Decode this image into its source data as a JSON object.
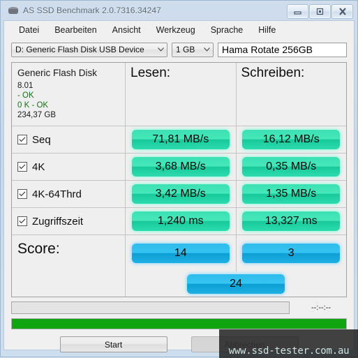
{
  "window": {
    "title": "AS SSD Benchmark 2.0.7316.34247",
    "icon": "disk-drive-icon",
    "buttons": {
      "minimize": "minimize-icon",
      "maximize": "restore-icon",
      "close": "close-icon"
    }
  },
  "menu": [
    "Datei",
    "Bearbeiten",
    "Ansicht",
    "Werkzeug",
    "Sprache",
    "Hilfe"
  ],
  "selector": {
    "drive": "D: Generic Flash Disk USB Device",
    "size": "1 GB",
    "name_value": "Hama Rotate 256GB",
    "name_placeholder": ""
  },
  "device_info": {
    "model": "Generic Flash Disk",
    "firmware": "8.01",
    "alignment": "- OK",
    "partition": "0 K - OK",
    "capacity": "234,37 GB"
  },
  "columns": {
    "read": "Lesen:",
    "write": "Schreiben:"
  },
  "rows": [
    {
      "label": "Seq",
      "checked": true,
      "read": "71,81 MB/s",
      "write": "16,12 MB/s"
    },
    {
      "label": "4K",
      "checked": true,
      "read": "3,68 MB/s",
      "write": "0,35 MB/s"
    },
    {
      "label": "4K-64Thrd",
      "checked": true,
      "read": "3,42 MB/s",
      "write": "1,35 MB/s"
    },
    {
      "label": "Zugriffszeit",
      "checked": true,
      "read": "1,240 ms",
      "write": "13,327 ms"
    }
  ],
  "score": {
    "label": "Score:",
    "read": "14",
    "write": "3",
    "total": "24"
  },
  "status": {
    "message": "",
    "time": "--:--:--",
    "progress_percent": 100
  },
  "buttons": {
    "start": "Start",
    "cancel": "Abbrechen"
  },
  "watermark": "www.ssd-tester.com.au",
  "colors": {
    "bar_green": "#2ddcae",
    "bar_blue": "#1fb0e4",
    "progress_green": "#11a411",
    "ok_text": "#157215",
    "window_chrome": "#cddeee"
  }
}
